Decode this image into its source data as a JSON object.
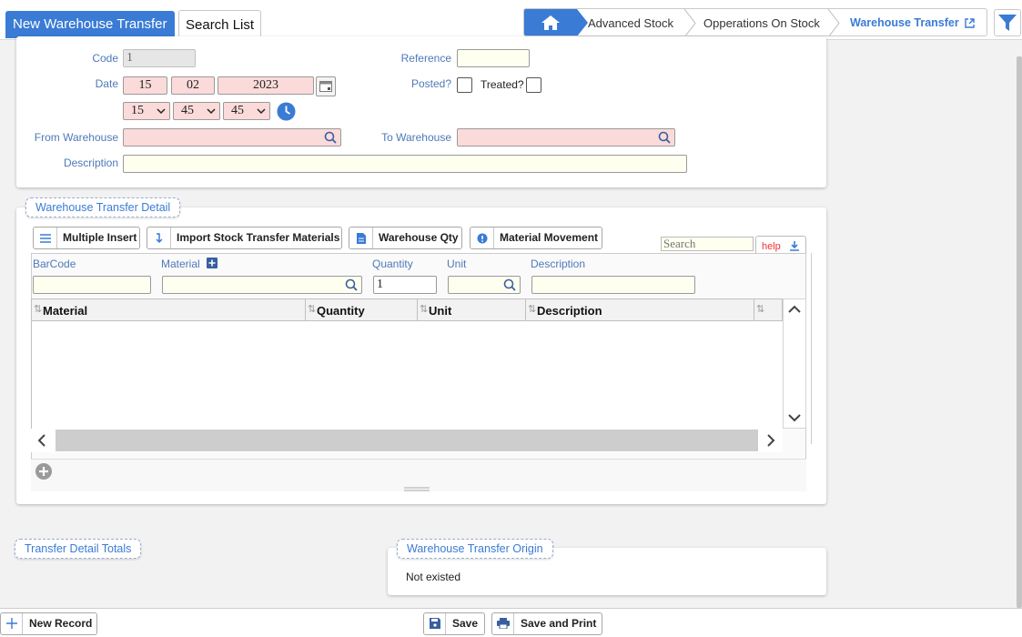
{
  "tabs": {
    "active": "New Warehouse Transfer",
    "search_list": "Search List"
  },
  "breadcrumb": {
    "items": [
      "Advanced Stock",
      "Opperations On Stock",
      "Warehouse Transfer"
    ]
  },
  "form": {
    "code_label": "Code",
    "code_value": "1",
    "reference_label": "Reference",
    "reference_value": "",
    "date_label": "Date",
    "date_day": "15",
    "date_month": "02",
    "date_year": "2023",
    "time_hour": "15",
    "time_minute": "45",
    "time_second": "45",
    "posted_label": "Posted?",
    "treated_label": "Treated?",
    "from_warehouse_label": "From Warehouse",
    "to_warehouse_label": "To Warehouse",
    "description_label": "Description"
  },
  "detail": {
    "title": "Warehouse Transfer Detail",
    "buttons": [
      "Multiple Insert",
      "Import Stock Transfer Materials",
      "Warehouse Qty",
      "Material Movement"
    ],
    "search_placeholder": "Search",
    "help_label": "help",
    "entry": {
      "barcode_label": "BarCode",
      "material_label": "Material",
      "quantity_label": "Quantity",
      "quantity_value": "1",
      "unit_label": "Unit",
      "description_label": "Description"
    },
    "columns": [
      "Material",
      "Quantity",
      "Unit",
      "Description"
    ]
  },
  "totals": {
    "title": "Transfer Detail Totals"
  },
  "origin": {
    "title": "Warehouse Transfer Origin",
    "status": "Not existed"
  },
  "footer": {
    "new_record": "New Record",
    "save": "Save",
    "save_print": "Save and Print"
  },
  "colors": {
    "accent": "#3a7bd5",
    "required_bg": "#fbdada",
    "optional_bg": "#fffff0"
  }
}
